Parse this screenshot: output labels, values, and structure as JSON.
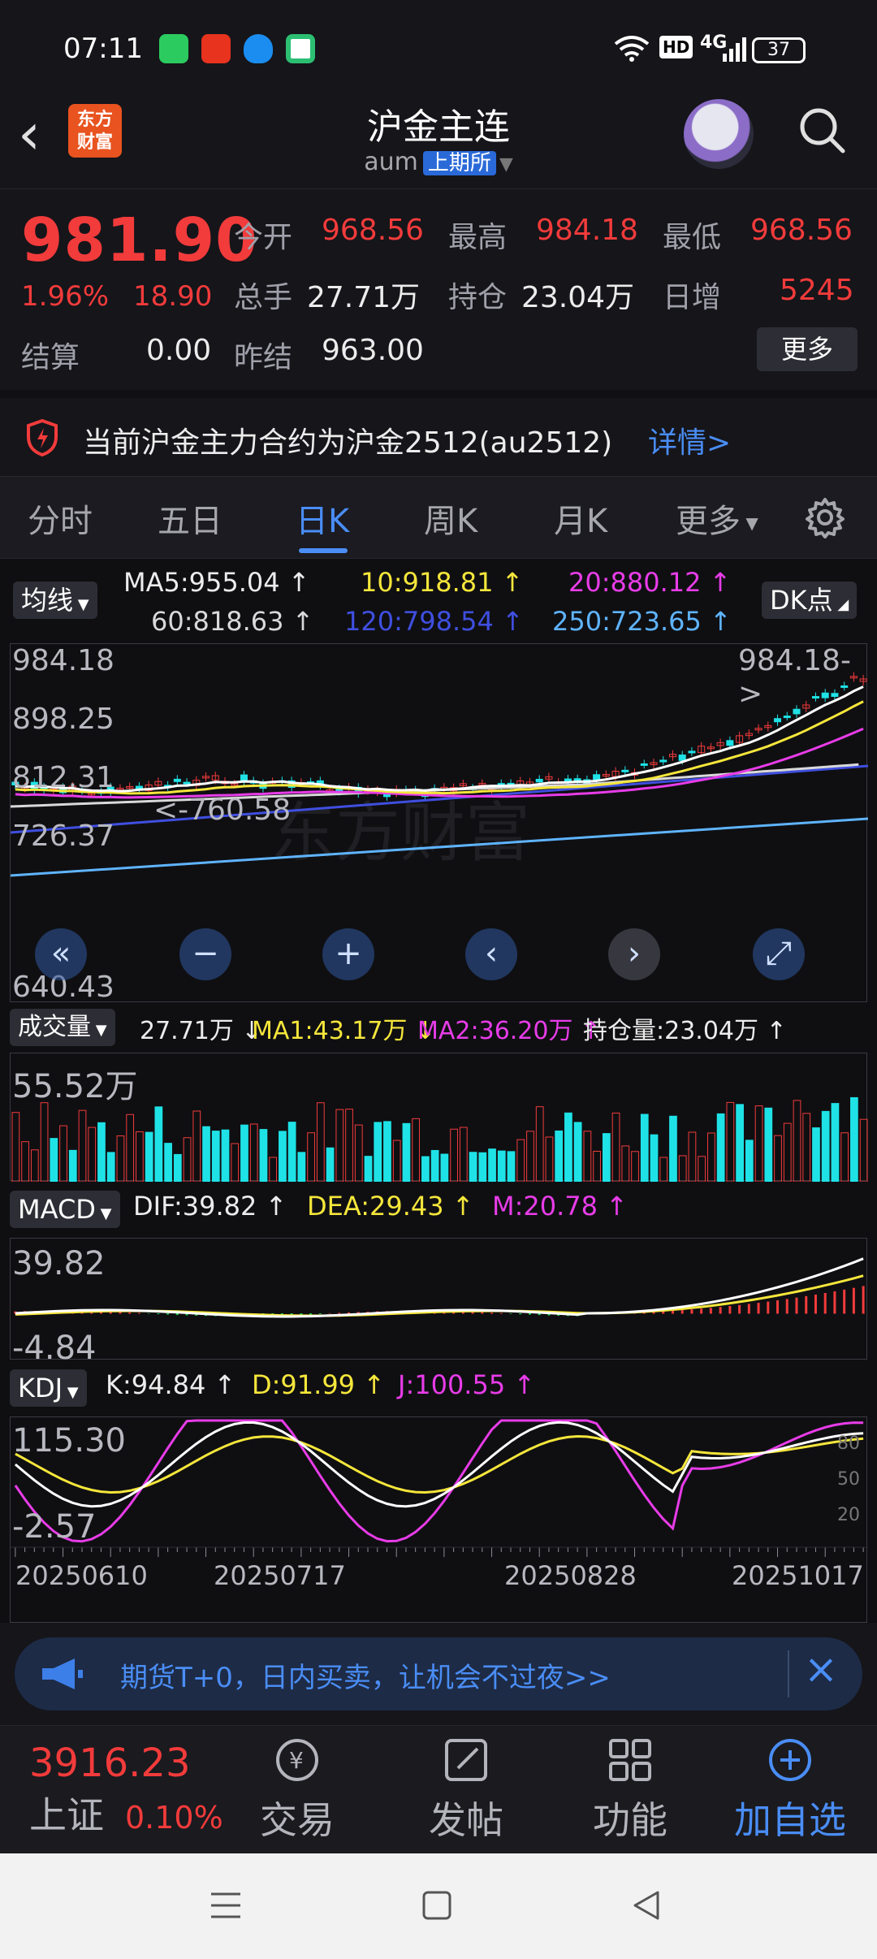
{
  "status": {
    "time": "07:11",
    "battery": "37",
    "net": "4G",
    "hd": "HD"
  },
  "header": {
    "title": "沪金主连",
    "code": "aum",
    "exchange": "上期所",
    "logo_line1": "东方",
    "logo_line2": "财富"
  },
  "quote": {
    "last": "981.90",
    "pct": "1.96%",
    "chg": "18.90",
    "open_label": "今开",
    "open": "968.56",
    "high_label": "最高",
    "high": "984.18",
    "low_label": "最低",
    "low": "968.56",
    "vol_label": "总手",
    "vol": "27.71万",
    "oi_label": "持仓",
    "oi": "23.04万",
    "dayinc_label": "日增",
    "dayinc": "5245",
    "settle_label": "结算",
    "settle": "0.00",
    "prevsettle_label": "昨结",
    "prevsettle": "963.00",
    "more": "更多"
  },
  "notice": {
    "text": "当前沪金主力合约为沪金2512(au2512)",
    "link": "详情>"
  },
  "tabs": [
    "分时",
    "五日",
    "日K",
    "周K",
    "月K",
    "更多"
  ],
  "chart": {
    "ma_btn": "均线",
    "ma5": "MA5:955.04 ↑",
    "ma10": "10:918.81 ↑",
    "ma20": "20:880.12 ↑",
    "ma60": "60:818.63 ↑",
    "ma120": "120:798.54 ↑",
    "ma250": "250:723.65 ↑",
    "dk_btn": "DK点",
    "price_axis": [
      "984.18",
      "898.25",
      "812.31",
      "726.37",
      "640.43"
    ],
    "high_marker": "984.18->",
    "low_marker": "<-760.58",
    "watermark": "东方财富",
    "vol_btn": "成交量",
    "vol_val": "27.71万 ↓",
    "vol_ma1": "MA1:43.17万 ↓",
    "vol_ma2": "MA2:36.20万 ↑",
    "vol_oi": "持仓量:23.04万 ↑",
    "vol_axis": "55.52万",
    "macd_btn": "MACD",
    "dif": "DIF:39.82 ↑",
    "dea": "DEA:29.43 ↑",
    "m": "M:20.78 ↑",
    "macd_axis_top": "39.82",
    "macd_axis_bot": "-4.84",
    "kdj_btn": "KDJ",
    "k": "K:94.84 ↑",
    "d": "D:91.99 ↑",
    "j": "J:100.55 ↑",
    "kdj_axis_top": "115.30",
    "kdj_axis_bot": "-2.57",
    "kdj_ticks": [
      "80",
      "50",
      "20"
    ],
    "dates": [
      "20250610",
      "20250717",
      "20250828",
      "20251017"
    ]
  },
  "banner": {
    "text": "期货T+0，日内买卖，让机会不过夜>>"
  },
  "bottom": {
    "index_val": "3916.23",
    "index_name": "上证",
    "index_pct": "0.10%",
    "trade": "交易",
    "post": "发帖",
    "func": "功能",
    "add": "加自选"
  },
  "colors": {
    "up": "#f23b3b",
    "accent": "#4a8df5",
    "ma5": "#ffffff",
    "ma10": "#f5e63b",
    "ma20": "#e83ce8",
    "ma60": "#d9d9d9",
    "ma120": "#3f4fe0",
    "ma250": "#5fb4ff",
    "down": "#1fe2e6"
  }
}
